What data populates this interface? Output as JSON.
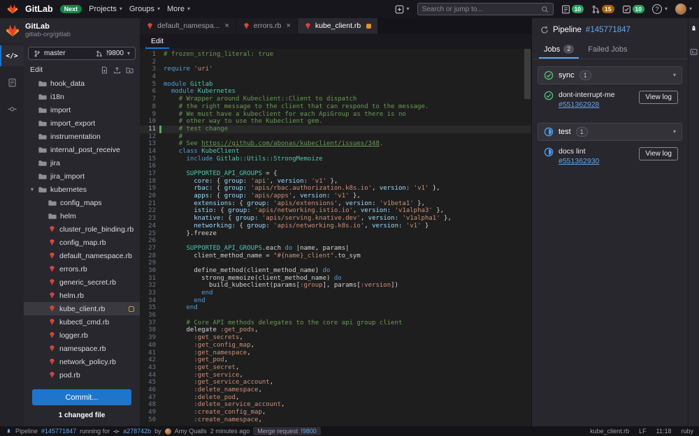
{
  "colors": {
    "accent_link": "#63a6e9",
    "primary_button": "#1f75cb",
    "success_green": "#2da160",
    "running_blue": "#4b9ff5",
    "warning_badge": "#ab6100",
    "ruby_icon_red": "#e64e41",
    "modified_orange": "#d99530",
    "changed_line_green": "#57ab5a"
  },
  "icons": {
    "chevron_down": "▾",
    "close": "×",
    "edit_mode_glyph": "</>",
    "help_glyph": "?"
  },
  "navbar": {
    "brand": "GitLab",
    "next_badge": "Next",
    "menu": [
      "Projects",
      "Groups",
      "More"
    ],
    "search_placeholder": "Search or jump to...",
    "badges": {
      "issues": "10",
      "merge_requests": "15",
      "todos": "10"
    }
  },
  "sidebar": {
    "project_name": "GitLab",
    "project_namespace": "gitlab-org/gitlab",
    "branch": "master",
    "merge_request": "!9800",
    "panel_title": "Edit",
    "commit_button": "Commit...",
    "changed_files": "1 changed file",
    "tree": [
      {
        "label": "hook_data",
        "type": "folder",
        "depth": 0
      },
      {
        "label": "i18n",
        "type": "folder",
        "depth": 0
      },
      {
        "label": "import",
        "type": "folder",
        "depth": 0
      },
      {
        "label": "import_export",
        "type": "folder",
        "depth": 0
      },
      {
        "label": "instrumentation",
        "type": "folder",
        "depth": 0
      },
      {
        "label": "internal_post_receive",
        "type": "folder",
        "depth": 0
      },
      {
        "label": "jira",
        "type": "folder",
        "depth": 0
      },
      {
        "label": "jira_import",
        "type": "folder",
        "depth": 0
      },
      {
        "label": "kubernetes",
        "type": "folder",
        "depth": 0,
        "open": true
      },
      {
        "label": "config_maps",
        "type": "folder",
        "depth": 1
      },
      {
        "label": "helm",
        "type": "folder",
        "depth": 1
      },
      {
        "label": "cluster_role_binding.rb",
        "type": "ruby",
        "depth": 1
      },
      {
        "label": "config_map.rb",
        "type": "ruby",
        "depth": 1
      },
      {
        "label": "default_namespace.rb",
        "type": "ruby",
        "depth": 1
      },
      {
        "label": "errors.rb",
        "type": "ruby",
        "depth": 1
      },
      {
        "label": "generic_secret.rb",
        "type": "ruby",
        "depth": 1
      },
      {
        "label": "helm.rb",
        "type": "ruby",
        "depth": 1
      },
      {
        "label": "kube_client.rb",
        "type": "ruby",
        "depth": 1,
        "selected": true,
        "modified": true
      },
      {
        "label": "kubectl_cmd.rb",
        "type": "ruby",
        "depth": 1
      },
      {
        "label": "logger.rb",
        "type": "ruby",
        "depth": 1
      },
      {
        "label": "namespace.rb",
        "type": "ruby",
        "depth": 1
      },
      {
        "label": "network_policy.rb",
        "type": "ruby",
        "depth": 1
      },
      {
        "label": "pod.rb",
        "type": "ruby",
        "depth": 1
      }
    ]
  },
  "tabs": [
    {
      "label": "default_namespa...",
      "close": true
    },
    {
      "label": "errors.rb",
      "close": true
    },
    {
      "label": "kube_client.rb",
      "active": true,
      "modified": true
    }
  ],
  "editor": {
    "mode_tab": "Edit",
    "cursor_line": 11,
    "changed_lines": [
      11
    ],
    "lines": [
      [
        [
          "cm",
          "# frozen_string_literal: true"
        ]
      ],
      [],
      [
        [
          "kw",
          "require"
        ],
        [
          "pl",
          " "
        ],
        [
          "str",
          "'uri'"
        ]
      ],
      [],
      [
        [
          "kw",
          "module"
        ],
        [
          "pl",
          " "
        ],
        [
          "cls",
          "Gitlab"
        ]
      ],
      [
        [
          "pl",
          "  "
        ],
        [
          "kw",
          "module"
        ],
        [
          "pl",
          " "
        ],
        [
          "cls",
          "Kubernetes"
        ]
      ],
      [
        [
          "pl",
          "    "
        ],
        [
          "cm",
          "# Wrapper around Kubeclient::Client to dispatch"
        ]
      ],
      [
        [
          "pl",
          "    "
        ],
        [
          "cm",
          "# the right message to the client that can respond to the message."
        ]
      ],
      [
        [
          "pl",
          "    "
        ],
        [
          "cm",
          "# We must have a kubeclient for each ApiGroup as there is no"
        ]
      ],
      [
        [
          "pl",
          "    "
        ],
        [
          "cm",
          "# other way to use the Kubeclient gem."
        ]
      ],
      [
        [
          "pl",
          "    "
        ],
        [
          "cm",
          "# test change"
        ]
      ],
      [
        [
          "pl",
          "    "
        ],
        [
          "cm",
          "#"
        ]
      ],
      [
        [
          "pl",
          "    "
        ],
        [
          "cm",
          "# See "
        ],
        [
          "cml",
          "https://github.com/abonas/kubeclient/issues/348"
        ],
        [
          "cm",
          "."
        ]
      ],
      [
        [
          "pl",
          "    "
        ],
        [
          "kw",
          "class"
        ],
        [
          "pl",
          " "
        ],
        [
          "cls",
          "KubeClient"
        ]
      ],
      [
        [
          "pl",
          "      "
        ],
        [
          "kw",
          "include"
        ],
        [
          "pl",
          " "
        ],
        [
          "cls",
          "Gitlab::Utils::StrongMemoize"
        ]
      ],
      [],
      [
        [
          "pl",
          "      "
        ],
        [
          "cls",
          "SUPPORTED_API_GROUPS"
        ],
        [
          "pl",
          " = {"
        ]
      ],
      [
        [
          "pl",
          "        "
        ],
        [
          "key",
          "core:"
        ],
        [
          "pl",
          " { "
        ],
        [
          "key",
          "group:"
        ],
        [
          "pl",
          " "
        ],
        [
          "str",
          "'api'"
        ],
        [
          "pl",
          ", "
        ],
        [
          "key",
          "version:"
        ],
        [
          "pl",
          " "
        ],
        [
          "str",
          "'v1'"
        ],
        [
          "pl",
          " },"
        ]
      ],
      [
        [
          "pl",
          "        "
        ],
        [
          "key",
          "rbac:"
        ],
        [
          "pl",
          " { "
        ],
        [
          "key",
          "group:"
        ],
        [
          "pl",
          " "
        ],
        [
          "str",
          "'apis/rbac.authorization.k8s.io'"
        ],
        [
          "pl",
          ", "
        ],
        [
          "key",
          "version:"
        ],
        [
          "pl",
          " "
        ],
        [
          "str",
          "'v1'"
        ],
        [
          "pl",
          " },"
        ]
      ],
      [
        [
          "pl",
          "        "
        ],
        [
          "key",
          "apps:"
        ],
        [
          "pl",
          " { "
        ],
        [
          "key",
          "group:"
        ],
        [
          "pl",
          " "
        ],
        [
          "str",
          "'apis/apps'"
        ],
        [
          "pl",
          ", "
        ],
        [
          "key",
          "version:"
        ],
        [
          "pl",
          " "
        ],
        [
          "str",
          "'v1'"
        ],
        [
          "pl",
          " },"
        ]
      ],
      [
        [
          "pl",
          "        "
        ],
        [
          "key",
          "extensions:"
        ],
        [
          "pl",
          " { "
        ],
        [
          "key",
          "group:"
        ],
        [
          "pl",
          " "
        ],
        [
          "str",
          "'apis/extensions'"
        ],
        [
          "pl",
          ", "
        ],
        [
          "key",
          "version:"
        ],
        [
          "pl",
          " "
        ],
        [
          "str",
          "'v1beta1'"
        ],
        [
          "pl",
          " },"
        ]
      ],
      [
        [
          "pl",
          "        "
        ],
        [
          "key",
          "istio:"
        ],
        [
          "pl",
          " { "
        ],
        [
          "key",
          "group:"
        ],
        [
          "pl",
          " "
        ],
        [
          "str",
          "'apis/networking.istio.io'"
        ],
        [
          "pl",
          ", "
        ],
        [
          "key",
          "version:"
        ],
        [
          "pl",
          " "
        ],
        [
          "str",
          "'v1alpha3'"
        ],
        [
          "pl",
          " },"
        ]
      ],
      [
        [
          "pl",
          "        "
        ],
        [
          "key",
          "knative:"
        ],
        [
          "pl",
          " { "
        ],
        [
          "key",
          "group:"
        ],
        [
          "pl",
          " "
        ],
        [
          "str",
          "'apis/serving.knative.dev'"
        ],
        [
          "pl",
          ", "
        ],
        [
          "key",
          "version:"
        ],
        [
          "pl",
          " "
        ],
        [
          "str",
          "'v1alpha1'"
        ],
        [
          "pl",
          " },"
        ]
      ],
      [
        [
          "pl",
          "        "
        ],
        [
          "key",
          "networking:"
        ],
        [
          "pl",
          " { "
        ],
        [
          "key",
          "group:"
        ],
        [
          "pl",
          " "
        ],
        [
          "str",
          "'apis/networking.k8s.io'"
        ],
        [
          "pl",
          ", "
        ],
        [
          "key",
          "version:"
        ],
        [
          "pl",
          " "
        ],
        [
          "str",
          "'v1'"
        ],
        [
          "pl",
          " }"
        ]
      ],
      [
        [
          "pl",
          "      }.freeze"
        ]
      ],
      [],
      [
        [
          "pl",
          "      "
        ],
        [
          "cls",
          "SUPPORTED_API_GROUPS"
        ],
        [
          "pl",
          ".each "
        ],
        [
          "kw",
          "do"
        ],
        [
          "pl",
          " |name, params|"
        ]
      ],
      [
        [
          "pl",
          "        client_method_name = "
        ],
        [
          "str",
          "\"#{name}_client\""
        ],
        [
          "pl",
          ".to_sym"
        ]
      ],
      [],
      [
        [
          "pl",
          "        define_method(client_method_name) "
        ],
        [
          "kw",
          "do"
        ]
      ],
      [
        [
          "pl",
          "          strong_memoize(client_method_name) "
        ],
        [
          "kw",
          "do"
        ]
      ],
      [
        [
          "pl",
          "            build_kubeclient(params["
        ],
        [
          "str",
          ":group"
        ],
        [
          "pl",
          "], params["
        ],
        [
          "str",
          ":version"
        ],
        [
          "pl",
          "])"
        ]
      ],
      [
        [
          "pl",
          "          "
        ],
        [
          "kw",
          "end"
        ]
      ],
      [
        [
          "pl",
          "        "
        ],
        [
          "kw",
          "end"
        ]
      ],
      [
        [
          "pl",
          "      "
        ],
        [
          "kw",
          "end"
        ]
      ],
      [],
      [
        [
          "pl",
          "      "
        ],
        [
          "cm",
          "# Core API methods delegates to the core api group client"
        ]
      ],
      [
        [
          "pl",
          "      delegate "
        ],
        [
          "str",
          ":get_pods"
        ],
        [
          "pl",
          ","
        ]
      ],
      [
        [
          "pl",
          "        "
        ],
        [
          "str",
          ":get_secrets"
        ],
        [
          "pl",
          ","
        ]
      ],
      [
        [
          "pl",
          "        "
        ],
        [
          "str",
          ":get_config_map"
        ],
        [
          "pl",
          ","
        ]
      ],
      [
        [
          "pl",
          "        "
        ],
        [
          "str",
          ":get_namespace"
        ],
        [
          "pl",
          ","
        ]
      ],
      [
        [
          "pl",
          "        "
        ],
        [
          "str",
          ":get_pod"
        ],
        [
          "pl",
          ","
        ]
      ],
      [
        [
          "pl",
          "        "
        ],
        [
          "str",
          ":get_secret"
        ],
        [
          "pl",
          ","
        ]
      ],
      [
        [
          "pl",
          "        "
        ],
        [
          "str",
          ":get_service"
        ],
        [
          "pl",
          ","
        ]
      ],
      [
        [
          "pl",
          "        "
        ],
        [
          "str",
          ":get_service_account"
        ],
        [
          "pl",
          ","
        ]
      ],
      [
        [
          "pl",
          "        "
        ],
        [
          "str",
          ":delete_namespace"
        ],
        [
          "pl",
          ","
        ]
      ],
      [
        [
          "pl",
          "        "
        ],
        [
          "str",
          ":delete_pod"
        ],
        [
          "pl",
          ","
        ]
      ],
      [
        [
          "pl",
          "        "
        ],
        [
          "str",
          ":delete_service_account"
        ],
        [
          "pl",
          ","
        ]
      ],
      [
        [
          "pl",
          "        "
        ],
        [
          "str",
          ":create_config_map"
        ],
        [
          "pl",
          ","
        ]
      ],
      [
        [
          "pl",
          "        "
        ],
        [
          "str",
          ":create_namespace"
        ],
        [
          "pl",
          ","
        ]
      ]
    ]
  },
  "pipeline_panel": {
    "title": "Pipeline",
    "pipeline_id": "#145771847",
    "tabs": [
      {
        "label": "Jobs",
        "count": "2"
      },
      {
        "label": "Failed Jobs"
      }
    ],
    "stages": [
      {
        "name": "sync",
        "count": "1",
        "status": "success",
        "jobs": [
          {
            "name": "dont-interrupt-me",
            "id": "#551362928",
            "status": "success",
            "action": "View log"
          }
        ]
      },
      {
        "name": "test",
        "count": "1",
        "status": "running",
        "jobs": [
          {
            "name": "docs lint",
            "id": "#551362930",
            "status": "running",
            "action": "View log"
          }
        ]
      }
    ]
  },
  "statusbar": {
    "pipeline_label": "Pipeline",
    "pipeline_id": "#145771847",
    "running_for": "running for",
    "commit_sha": "a278742b",
    "by_label": "by",
    "author": "Amy Qualls",
    "time_ago": "2 minutes ago",
    "mr_label": "Merge request",
    "mr_id": "!9800",
    "file_name": "kube_client.rb",
    "eol": "LF",
    "cursor_position": "11:18",
    "language": "ruby"
  }
}
